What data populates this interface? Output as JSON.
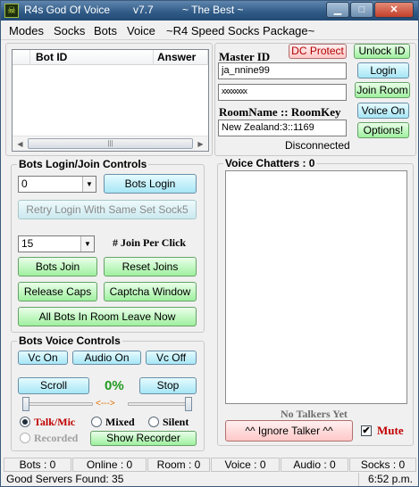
{
  "window": {
    "title": "R4s God Of Voice",
    "version": "v7.7",
    "tagline": "~ The Best ~",
    "icon_glyph": "☠"
  },
  "menu": [
    "Modes",
    "Socks",
    "Bots",
    "Voice",
    "~R4 Speed Socks Package~"
  ],
  "bot_table": {
    "columns": [
      "Bot ID",
      "Answer"
    ],
    "rows": []
  },
  "login": {
    "master_id_label": "Master ID",
    "master_id_value": "ja_nnine99",
    "password_value": "xxxxxxxx",
    "room_label": "RoomName :: RoomKey",
    "room_value": "New Zealand:3::1169",
    "status": "Disconnected",
    "buttons": {
      "dc_protect": "DC Protect",
      "unlock_id": "Unlock ID",
      "login": "Login",
      "join_room": "Join Room",
      "voice_on": "Voice On",
      "options": "Options!"
    }
  },
  "bots_login": {
    "title": "Bots Login/Join Controls",
    "combo_value": "0",
    "bots_login_btn": "Bots Login",
    "retry_btn": "Retry Login With Same Set Sock5",
    "join_combo_value": "15",
    "join_per_click_label": "# Join Per Click",
    "bots_join_btn": "Bots Join",
    "reset_joins_btn": "Reset Joins",
    "release_caps_btn": "Release Caps",
    "captcha_btn": "Captcha Window",
    "leave_all_btn": "All Bots In Room Leave Now"
  },
  "bots_voice": {
    "title": "Bots Voice Controls",
    "vc_on": "Vc On",
    "audio_on": "Audio On",
    "vc_off": "Vc Off",
    "scroll_btn": "Scroll",
    "percent": "0%",
    "arrow_glyph": "<--->",
    "stop_btn": "Stop",
    "radio_talk": "Talk/Mic",
    "radio_mixed": "Mixed",
    "radio_silent": "Silent",
    "radio_recorded": "Recorded",
    "show_recorder_btn": "Show Recorder",
    "slider_left_value": 0,
    "slider_right_value": 0
  },
  "voice_chatters": {
    "title": "Voice Chatters : 0",
    "no_talkers": "No Talkers Yet",
    "ignore_btn": "^^ Ignore Talker ^^",
    "mute_label": "Mute",
    "mute_checked": true,
    "check_glyph": "✔"
  },
  "status_bar": {
    "bots": "Bots : 0",
    "online": "Online : 0",
    "room": "Room : 0",
    "voice": "Voice : 0",
    "audio": "Audio : 0",
    "socks": "Socks : 0"
  },
  "footer": {
    "servers": "Good Servers Found: 35",
    "time": "6:52 p.m."
  },
  "colors": {
    "button_cyan": "#a7e6f5",
    "button_green": "#9ff09f",
    "button_pink": "#ffc7c7",
    "percent_green": "#1f9a1f",
    "talk_mic_red": "#c00000",
    "mute_red": "#c00000",
    "dc_protect_red": "#b00000",
    "titlebar": "#2f5a86"
  }
}
